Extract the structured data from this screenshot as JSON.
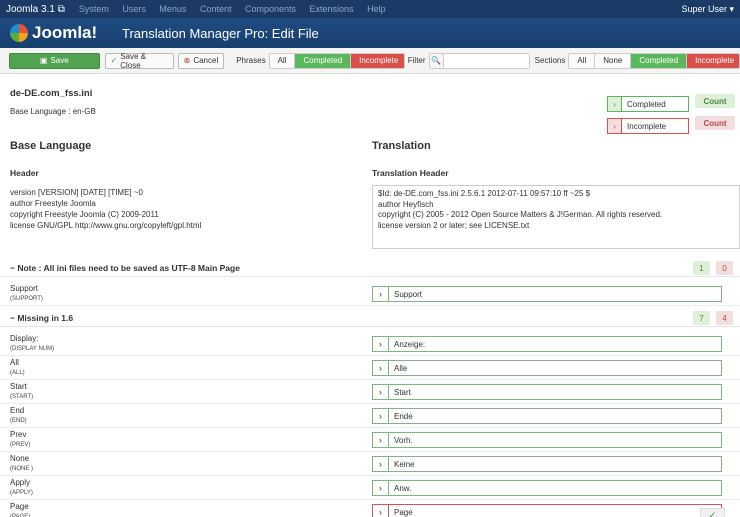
{
  "topbar": {
    "brand": "Joomla 3.1",
    "menu": [
      "System",
      "Users",
      "Menus",
      "Content",
      "Components",
      "Extensions",
      "Help"
    ],
    "user": "Super User ▾"
  },
  "header": {
    "logo": "Joomla!",
    "title": "Translation Manager Pro: Edit File"
  },
  "toolbar": {
    "save": "Save",
    "save_close": "Save & Close",
    "cancel": "Cancel",
    "phrases_label": "Phrases",
    "phrases": [
      "All",
      "Completed",
      "Incomplete"
    ],
    "filter_label": "Filter",
    "filter_value": "",
    "sections_label": "Sections",
    "sections": [
      "All",
      "None",
      "Completed",
      "Incomplete"
    ]
  },
  "file": {
    "name": "de-DE.com_fss.ini",
    "base_language": "Base Language : en-GB"
  },
  "legend": {
    "completed": "Completed",
    "incomplete": "Incomplete",
    "count": "Count"
  },
  "base": {
    "title": "Base Language",
    "header_title": "Header",
    "header_lines": [
      "version [VERSION] [DATE] [TIME] ~0",
      "author Freestyle Joomla",
      "copyright Freestyle Joomla (C) 2009-2011",
      "license GNU/GPL http://www.gnu.org/copyleft/gpl.html"
    ]
  },
  "translation": {
    "title": "Translation",
    "header_title": "Translation Header",
    "header_text": "$Id: de-DE.com_fss.ini 2.5.6.1 2012-07-11 09:57:10 ff ~25 $\nauthor Heyfisch\ncopyright (C) 2005 - 2012 Open Source Matters & J!German. All rights reserved.\nlicense version 2 or later; see LICENSE.txt"
  },
  "sections": [
    {
      "title": "−  Note : All ini files need to be saved as UTF-8 Main Page",
      "completed": "1",
      "incomplete": "0",
      "rows": [
        {
          "label": "Support",
          "key": "(SUPPORT)",
          "value": "Support",
          "status": "complete"
        }
      ]
    },
    {
      "title": "−  Missing in 1.6",
      "completed": "7",
      "incomplete": "4",
      "rows": [
        {
          "label": "Display:",
          "key": "(DISPLAY NUM)",
          "value": "Anzeige:",
          "status": "complete"
        },
        {
          "label": "All",
          "key": "(ALL)",
          "value": "Alle",
          "status": "complete"
        },
        {
          "label": "Start",
          "key": "(START)",
          "value": "Start",
          "status": "complete"
        },
        {
          "label": "End",
          "key": "(END)",
          "value": "Ende",
          "status": "complete"
        },
        {
          "label": "Prev",
          "key": "(PREV)",
          "value": "Vorh.",
          "status": "complete"
        },
        {
          "label": "None",
          "key": "(NONE )",
          "value": "Keine",
          "status": "complete"
        },
        {
          "label": "Apply",
          "key": "(APPLY)",
          "value": "Anw.",
          "status": "complete"
        },
        {
          "label": "Page",
          "key": "(PAGE)",
          "value": "Page",
          "status": "incomplete"
        }
      ]
    }
  ]
}
